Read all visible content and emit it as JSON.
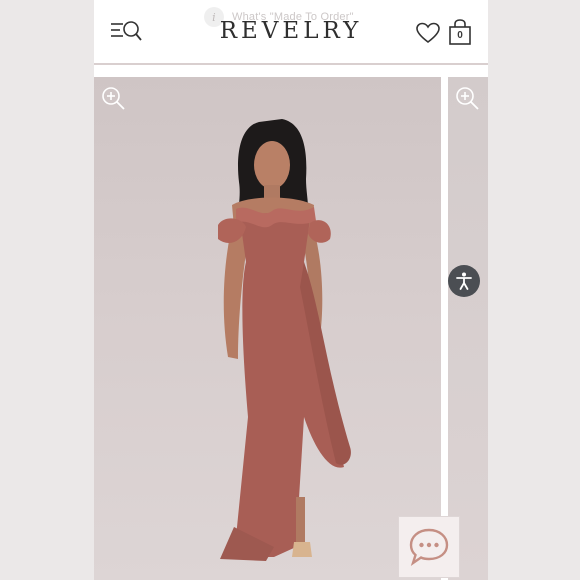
{
  "header": {
    "notice_text": "What's \"Made To Order\"",
    "notice_icon": "info-icon",
    "brand": "REVELRY",
    "bag_count": "0",
    "icons": [
      "menu-search-icon",
      "heart-icon",
      "shopping-bag-icon"
    ]
  },
  "gallery": {
    "controls": [
      "zoom-in-icon",
      "accessibility-icon",
      "chat-bubble-icon"
    ],
    "dress_color": "#a85e55",
    "background_color": "#d4caca"
  },
  "colors": {
    "header_rule": "#d9cfcf",
    "logo_text": "#2f2f2f",
    "accessibility_button": "#4b4e53"
  }
}
